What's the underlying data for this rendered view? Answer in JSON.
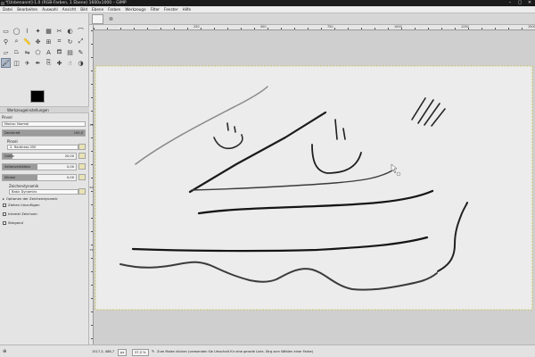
{
  "window": {
    "title": "*[Unbenannt]-1.0 (RGB-Farben, 1 Ebene) 1600x1000 – GIMP"
  },
  "menu": [
    "Datei",
    "Bearbeiten",
    "Auswahl",
    "Ansicht",
    "Bild",
    "Ebene",
    "Farben",
    "Werkzeuge",
    "Filter",
    "Fenster",
    "Hilfe"
  ],
  "toolbox": {
    "tools": [
      {
        "icon": "rect-select-icon",
        "glyph": "▭"
      },
      {
        "icon": "ellipse-select-icon",
        "glyph": "◯"
      },
      {
        "icon": "free-select-icon",
        "glyph": "⌇"
      },
      {
        "icon": "fuzzy-select-icon",
        "glyph": "✦"
      },
      {
        "icon": "color-select-icon",
        "glyph": "▦"
      },
      {
        "icon": "scissors-icon",
        "glyph": "✂"
      },
      {
        "icon": "foreground-select-icon",
        "glyph": "◐"
      },
      {
        "icon": "paths-icon",
        "glyph": "⌒"
      },
      {
        "icon": "color-picker-icon",
        "glyph": "⚲"
      },
      {
        "icon": "zoom-icon",
        "glyph": "⌕"
      },
      {
        "icon": "measure-icon",
        "glyph": "📏"
      },
      {
        "icon": "move-icon",
        "glyph": "✥"
      },
      {
        "icon": "align-icon",
        "glyph": "⊞"
      },
      {
        "icon": "crop-icon",
        "glyph": "⌗"
      },
      {
        "icon": "rotate-icon",
        "glyph": "↻"
      },
      {
        "icon": "scale-icon",
        "glyph": "⤢"
      },
      {
        "icon": "shear-icon",
        "glyph": "▱"
      },
      {
        "icon": "perspective-icon",
        "glyph": "⏢"
      },
      {
        "icon": "flip-icon",
        "glyph": "⇋"
      },
      {
        "icon": "cage-icon",
        "glyph": "⬠"
      },
      {
        "icon": "text-icon",
        "glyph": "A"
      },
      {
        "icon": "bucket-fill-icon",
        "glyph": "⛾"
      },
      {
        "icon": "gradient-icon",
        "glyph": "▤"
      },
      {
        "icon": "pencil-icon",
        "glyph": "✎"
      },
      {
        "icon": "paintbrush-icon",
        "glyph": "🖌"
      },
      {
        "icon": "eraser-icon",
        "glyph": "◫"
      },
      {
        "icon": "airbrush-icon",
        "glyph": "✈"
      },
      {
        "icon": "ink-icon",
        "glyph": "✒"
      },
      {
        "icon": "clone-icon",
        "glyph": "⎘"
      },
      {
        "icon": "heal-icon",
        "glyph": "✚"
      },
      {
        "icon": "smudge-icon",
        "glyph": "☝"
      },
      {
        "icon": "dodge-icon",
        "glyph": "◑"
      }
    ]
  },
  "tool_options": {
    "tab_label": "Werkzeugeinstellungen",
    "title": "Pinsel",
    "mode": "Modus: Normal",
    "opacity_label": "Deckkraft",
    "opacity_value": "100,0",
    "brush_label": "Pinsel",
    "brush_name": "2. Hardness 050",
    "size_label": "Größe",
    "size_value": "20,00",
    "aspect_label": "Seitenverhältnis",
    "aspect_value": "0,00",
    "angle_label": "Winkel",
    "angle_value": "0,00",
    "dynamics_label": "Zeichendynamik",
    "dynamics_name": "Basic Dynamics",
    "dynamics_options": "Optionen der Zeichendynamik",
    "check1": "Ziehen hinzufügen",
    "check2": "Inkrelei Zeichnen",
    "check3": "Steigend"
  },
  "ruler": {
    "h_labels": [
      "250",
      "500",
      "750",
      "1000",
      "1250",
      "1500"
    ],
    "v_labels": [
      "250",
      "500",
      "750"
    ]
  },
  "status": {
    "coords": "1517,3, 488,7",
    "unit": "px",
    "zoom": "37,5 %",
    "message": "Zum Malen klicken (verwenden Sie Umschalt für eine gerade Linie, Strg zum Wählen einer Farbe)"
  }
}
